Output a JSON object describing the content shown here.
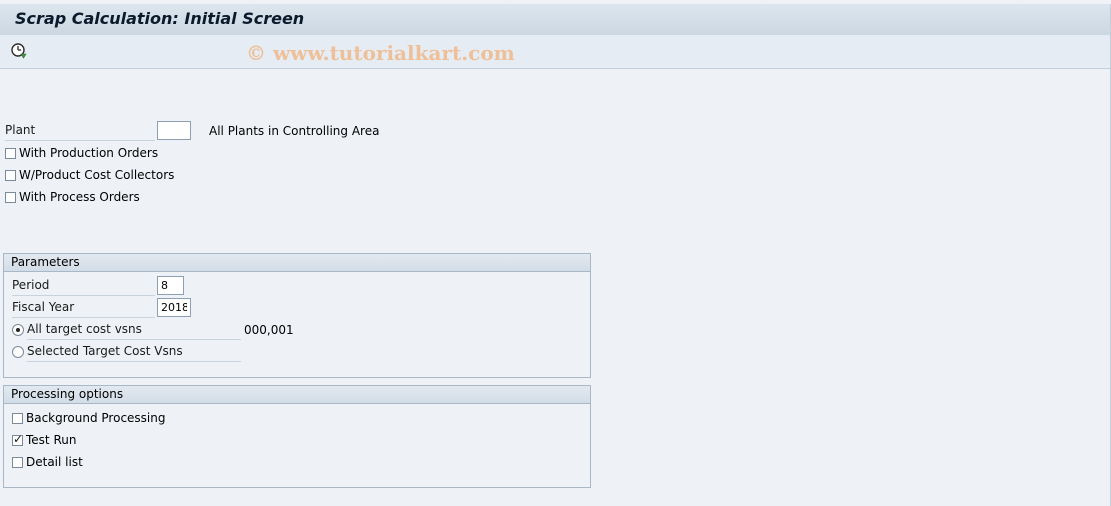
{
  "header": {
    "title": "Scrap Calculation: Initial Screen"
  },
  "toolbar": {
    "execute_icon": "execute-clock-icon",
    "watermark": "© www.tutorialkart.com"
  },
  "selection": {
    "plant_label": "Plant",
    "plant_value": "",
    "plant_hint": "All Plants in Controlling Area",
    "with_production_orders": {
      "label": "With Production Orders",
      "checked": false
    },
    "w_product_cost_collectors": {
      "label": "W/Product Cost Collectors",
      "checked": false
    },
    "with_process_orders": {
      "label": "With Process Orders",
      "checked": false
    }
  },
  "parameters": {
    "title": "Parameters",
    "period_label": "Period",
    "period_value": "8",
    "fiscal_year_label": "Fiscal Year",
    "fiscal_year_value": "2018",
    "all_target_label": "All target cost vsns",
    "all_target_value": "000,001",
    "all_target_selected": true,
    "selected_target_label": "Selected Target Cost Vsns",
    "selected_target_selected": false
  },
  "processing": {
    "title": "Processing options",
    "background_label": "Background Processing",
    "background_checked": false,
    "test_run_label": "Test Run",
    "test_run_checked": true,
    "detail_list_label": "Detail list",
    "detail_list_checked": false
  }
}
